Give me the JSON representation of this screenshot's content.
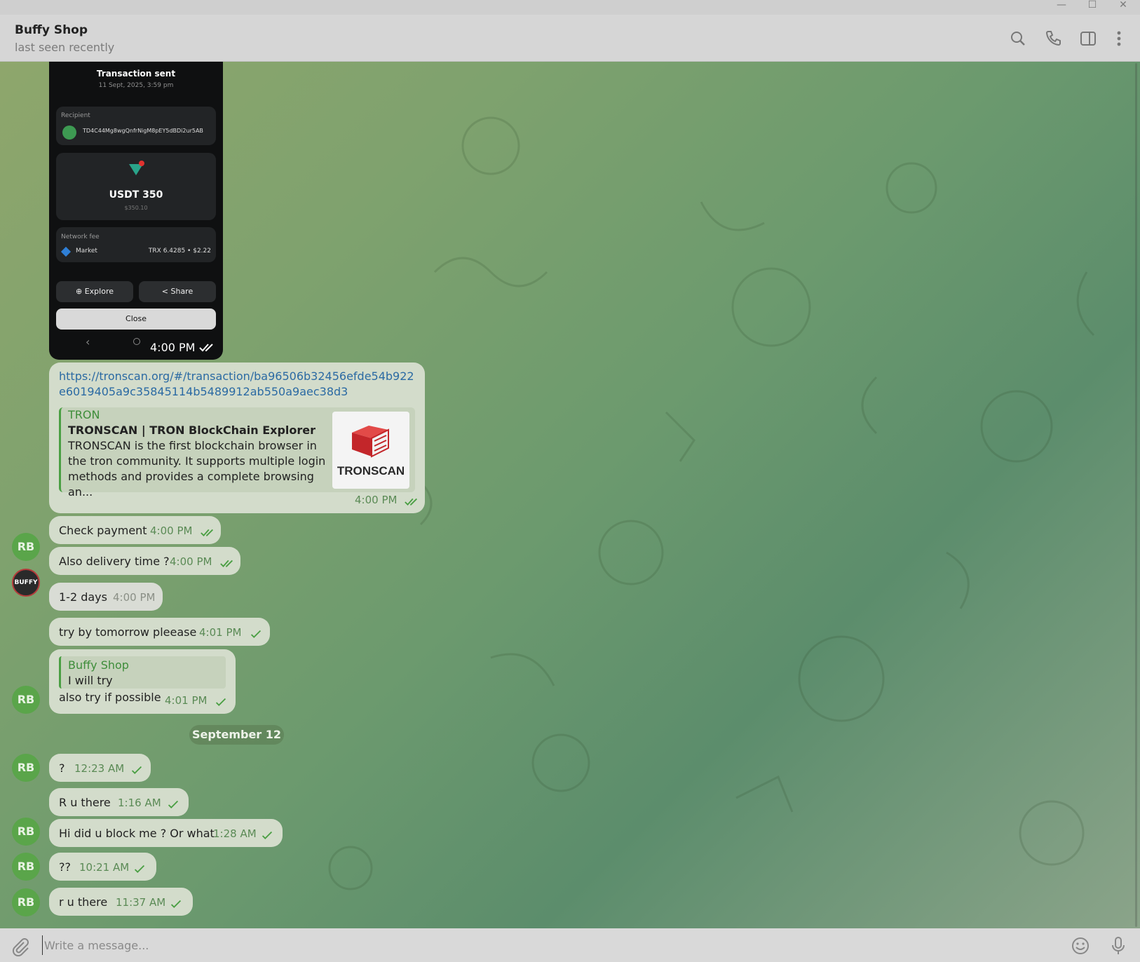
{
  "window": {
    "minimize": "—",
    "maximize": "☐",
    "close": "✕"
  },
  "header": {
    "chat_name": "Buffy Shop",
    "status": "last seen recently"
  },
  "screenshot": {
    "title": "Transaction sent",
    "date": "11 Sept, 2025, 3:59 pm",
    "recipient_label": "Recipient",
    "recipient_address": "TD4C44Mg8wgQnfrNigM8pEY5dBDi2ur5AB",
    "amount": "USDT 350",
    "amount_usd": "$350.10",
    "fee_label": "Network fee",
    "fee_type": "Market",
    "fee_value": "TRX 6.4285 • $2.22",
    "explore": "Explore",
    "share": "Share",
    "close": "Close",
    "time": "4:00 PM"
  },
  "link_message": {
    "url": "https://tronscan.org/#/transaction/ba96506b32456efde54b922e6019405a9c35845114b5489912ab550a9aec38d3",
    "site": "TRON",
    "title": "TRONSCAN | TRON BlockChain Explorer",
    "description": "TRONSCAN is the first blockchain browser in the tron community. It supports multiple login methods and provides a complete browsing an...",
    "thumb_label": "TRONSCAN",
    "time": "4:00 PM"
  },
  "messages": [
    {
      "text": "Check payment",
      "time": "4:00 PM"
    },
    {
      "text": "Also delivery time ?",
      "time": "4:00 PM",
      "avatar": "RB"
    },
    {
      "text": "1-2 days",
      "time": "4:00 PM"
    },
    {
      "text": "try by tomorrow pleease",
      "time": "4:01 PM"
    },
    {
      "reply_name": "Buffy Shop",
      "reply_text": "I will try",
      "text": "also try if possible",
      "time": "4:01 PM",
      "avatar": "RB"
    },
    {
      "text": "?",
      "time": "12:23 AM",
      "avatar": "RB"
    },
    {
      "text": "R u there",
      "time": "1:16 AM"
    },
    {
      "text": "Hi did u block me ? Or what",
      "time": "1:28 AM",
      "avatar": "RB"
    },
    {
      "text": "??",
      "time": "10:21 AM",
      "avatar": "RB"
    },
    {
      "text": "r u there",
      "time": "11:37 AM",
      "avatar": "RB"
    }
  ],
  "date_separator": "September 12",
  "composer": {
    "placeholder": "Write a message..."
  },
  "colors": {
    "outgoing_bubble": "#d3dccb",
    "incoming_bubble": "#d9dcd5",
    "accent_green": "#4a9f43",
    "link_blue": "#2b6aa3"
  }
}
